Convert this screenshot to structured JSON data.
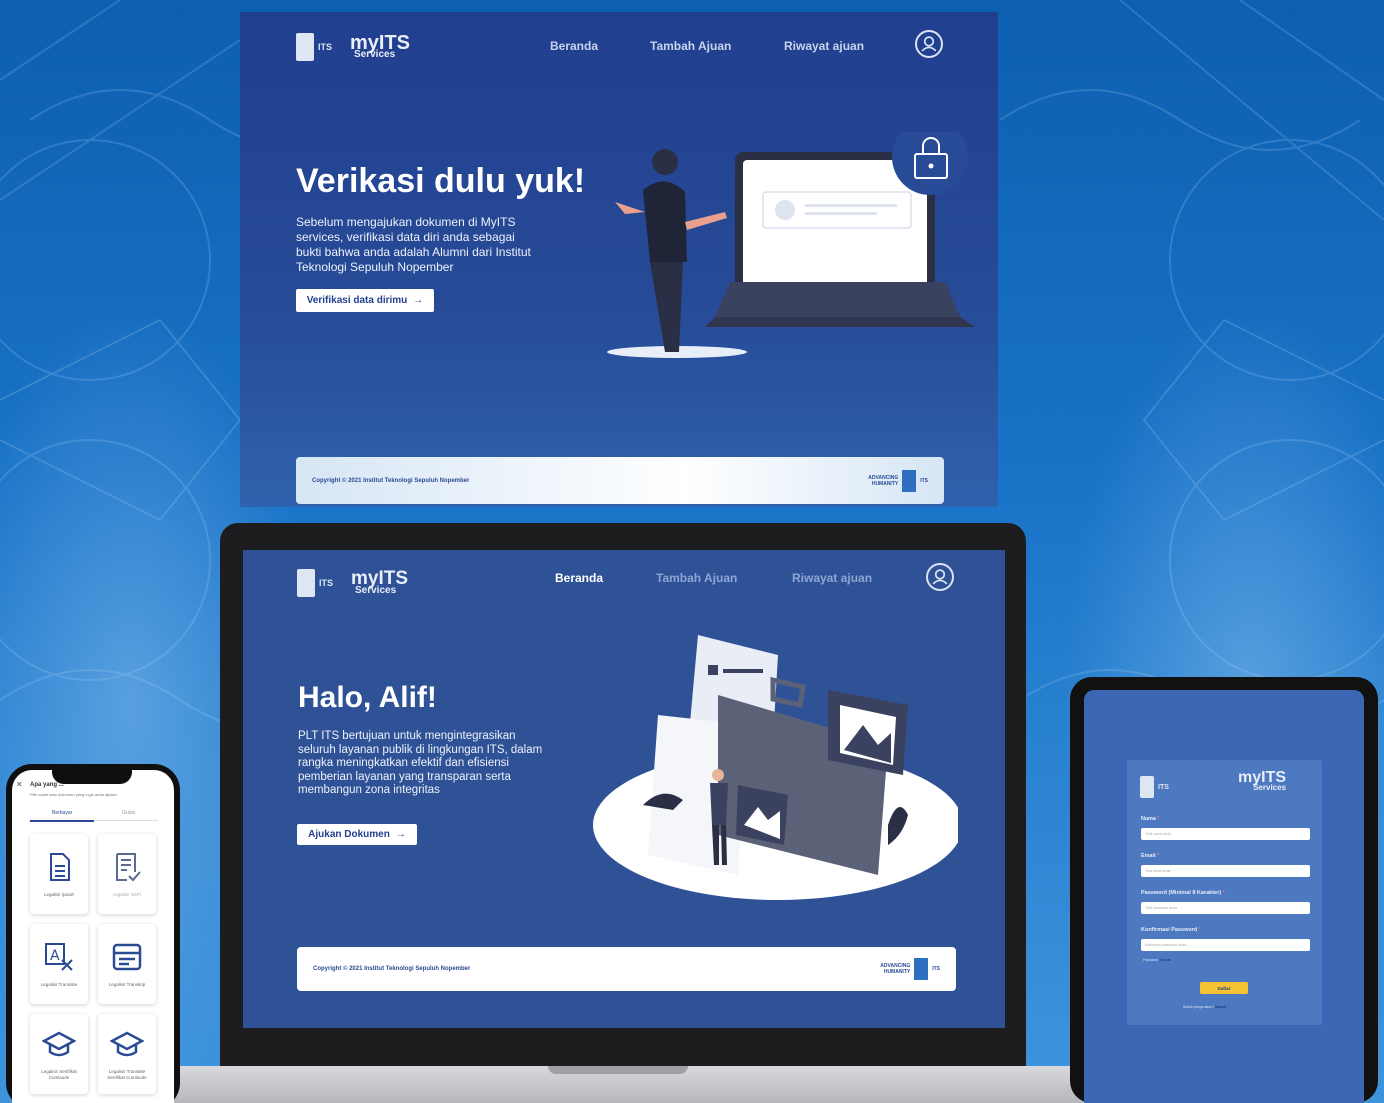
{
  "colors": {
    "background": "#1a74c8",
    "page_bg": "#274b97",
    "footer_bg": "#ffffff",
    "accent_yellow": "#f5c331"
  },
  "brand": {
    "name": "myITS",
    "sub": "Services",
    "its": "ITS"
  },
  "nav": {
    "items": [
      "Beranda",
      "Tambah Ajuan",
      "Riwayat ajuan"
    ],
    "profile_icon": "user-circle-icon"
  },
  "top_page": {
    "title": "Verikasi dulu yuk!",
    "text": "Sebelum mengajukan dokumen di MyITS services, verifikasi data diri anda sebagai bukti bahwa anda adalah Alumni dari Institut Teknologi Sepuluh Nopember",
    "cta": "Verifikasi data dirimu",
    "lock_icon": "lock-icon"
  },
  "laptop_page": {
    "title": "Halo, Alif!",
    "text": "PLT ITS bertujuan untuk mengintegrasikan seluruh layanan publik di lingkungan ITS, dalam rangka meningkatkan efektif dan efisiensi pemberian layanan yang transparan serta membangun zona integritas",
    "cta": "Ajukan Dokumen"
  },
  "footer": {
    "copyright": "Copyright © 2021 Institut Teknologi Sepuluh Nopember",
    "advancing": "ADVANCING",
    "humanity": "HUMANITY",
    "its": "ITS"
  },
  "phone": {
    "title": "Apa yang ...",
    "subtitle": "Pilih salah satu dokumen yang ingin anda ajukan",
    "tabs": [
      "Berbayar",
      "Gratis"
    ],
    "tiles": [
      {
        "label": "Legalisir Ijazah",
        "icon": "document-icon"
      },
      {
        "label": "Legalisir SKPI",
        "icon": "checklist-icon"
      },
      {
        "label": "Legalisir Translate",
        "icon": "translate-icon"
      },
      {
        "label": "Legalisir Transkrip",
        "icon": "id-card-icon"
      },
      {
        "label": "Legalisir Sertifikat Cumlaude",
        "icon": "graduation-cap-icon"
      },
      {
        "label": "Legalisir Translate Sertifikat Cumlaude",
        "icon": "graduation-cap-icon"
      }
    ]
  },
  "tablet": {
    "fields": [
      {
        "label": "Nama",
        "placeholder": "Tulis nama anda"
      },
      {
        "label": "Email",
        "placeholder": "Tulis email anda"
      },
      {
        "label": "Password (Minimal 8 Karakter)",
        "placeholder": "Tulis password anda"
      },
      {
        "label": "Konfirmasi Password",
        "placeholder": "Konfirmasi password anda"
      }
    ],
    "password_strength_label": "Password",
    "password_strength_value": "Sesuai",
    "submit": "Daftar",
    "login_prompt": "Sudah punya akun?",
    "login_link": "Masuk"
  }
}
